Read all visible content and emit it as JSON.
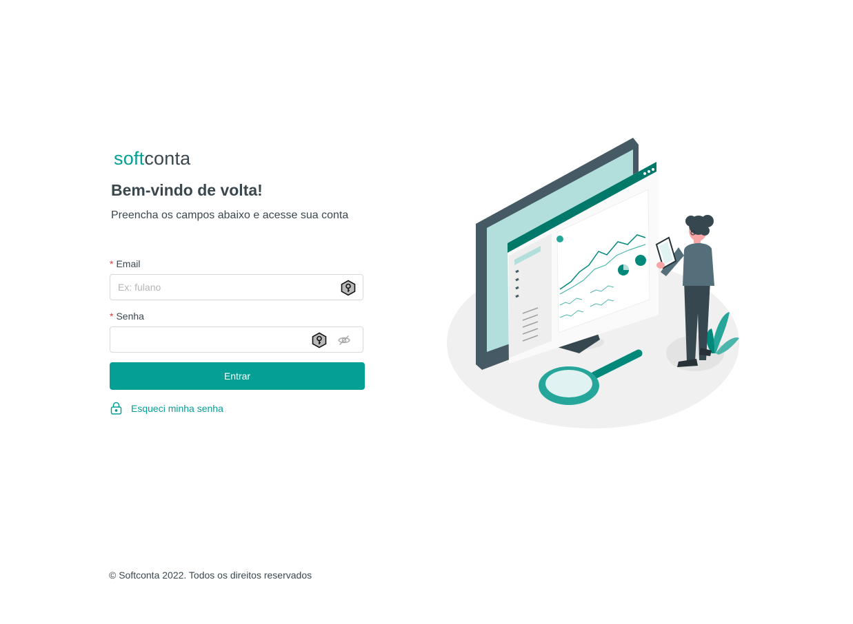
{
  "brand": {
    "logo_soft": "soft",
    "logo_conta": "conta",
    "accent_color": "#05a095"
  },
  "header": {
    "title": "Bem-vindo de volta!",
    "subtitle": "Preencha os campos abaixo e acesse sua conta"
  },
  "form": {
    "required_mark": "*",
    "email": {
      "label": "Email",
      "placeholder": "Ex: fulano",
      "value": "",
      "icon": "password-manager-key-icon"
    },
    "password": {
      "label": "Senha",
      "placeholder": "",
      "value": "",
      "icon": "password-manager-key-icon",
      "toggle_icon": "eye-off-icon"
    },
    "submit_label": "Entrar",
    "forgot": {
      "label": "Esqueci minha senha",
      "icon": "lock-icon"
    }
  },
  "illustration": {
    "icon": "dashboard-analytics-illustration"
  },
  "footer": {
    "copyright": "© Softconta 2022. Todos os direitos reservados"
  }
}
